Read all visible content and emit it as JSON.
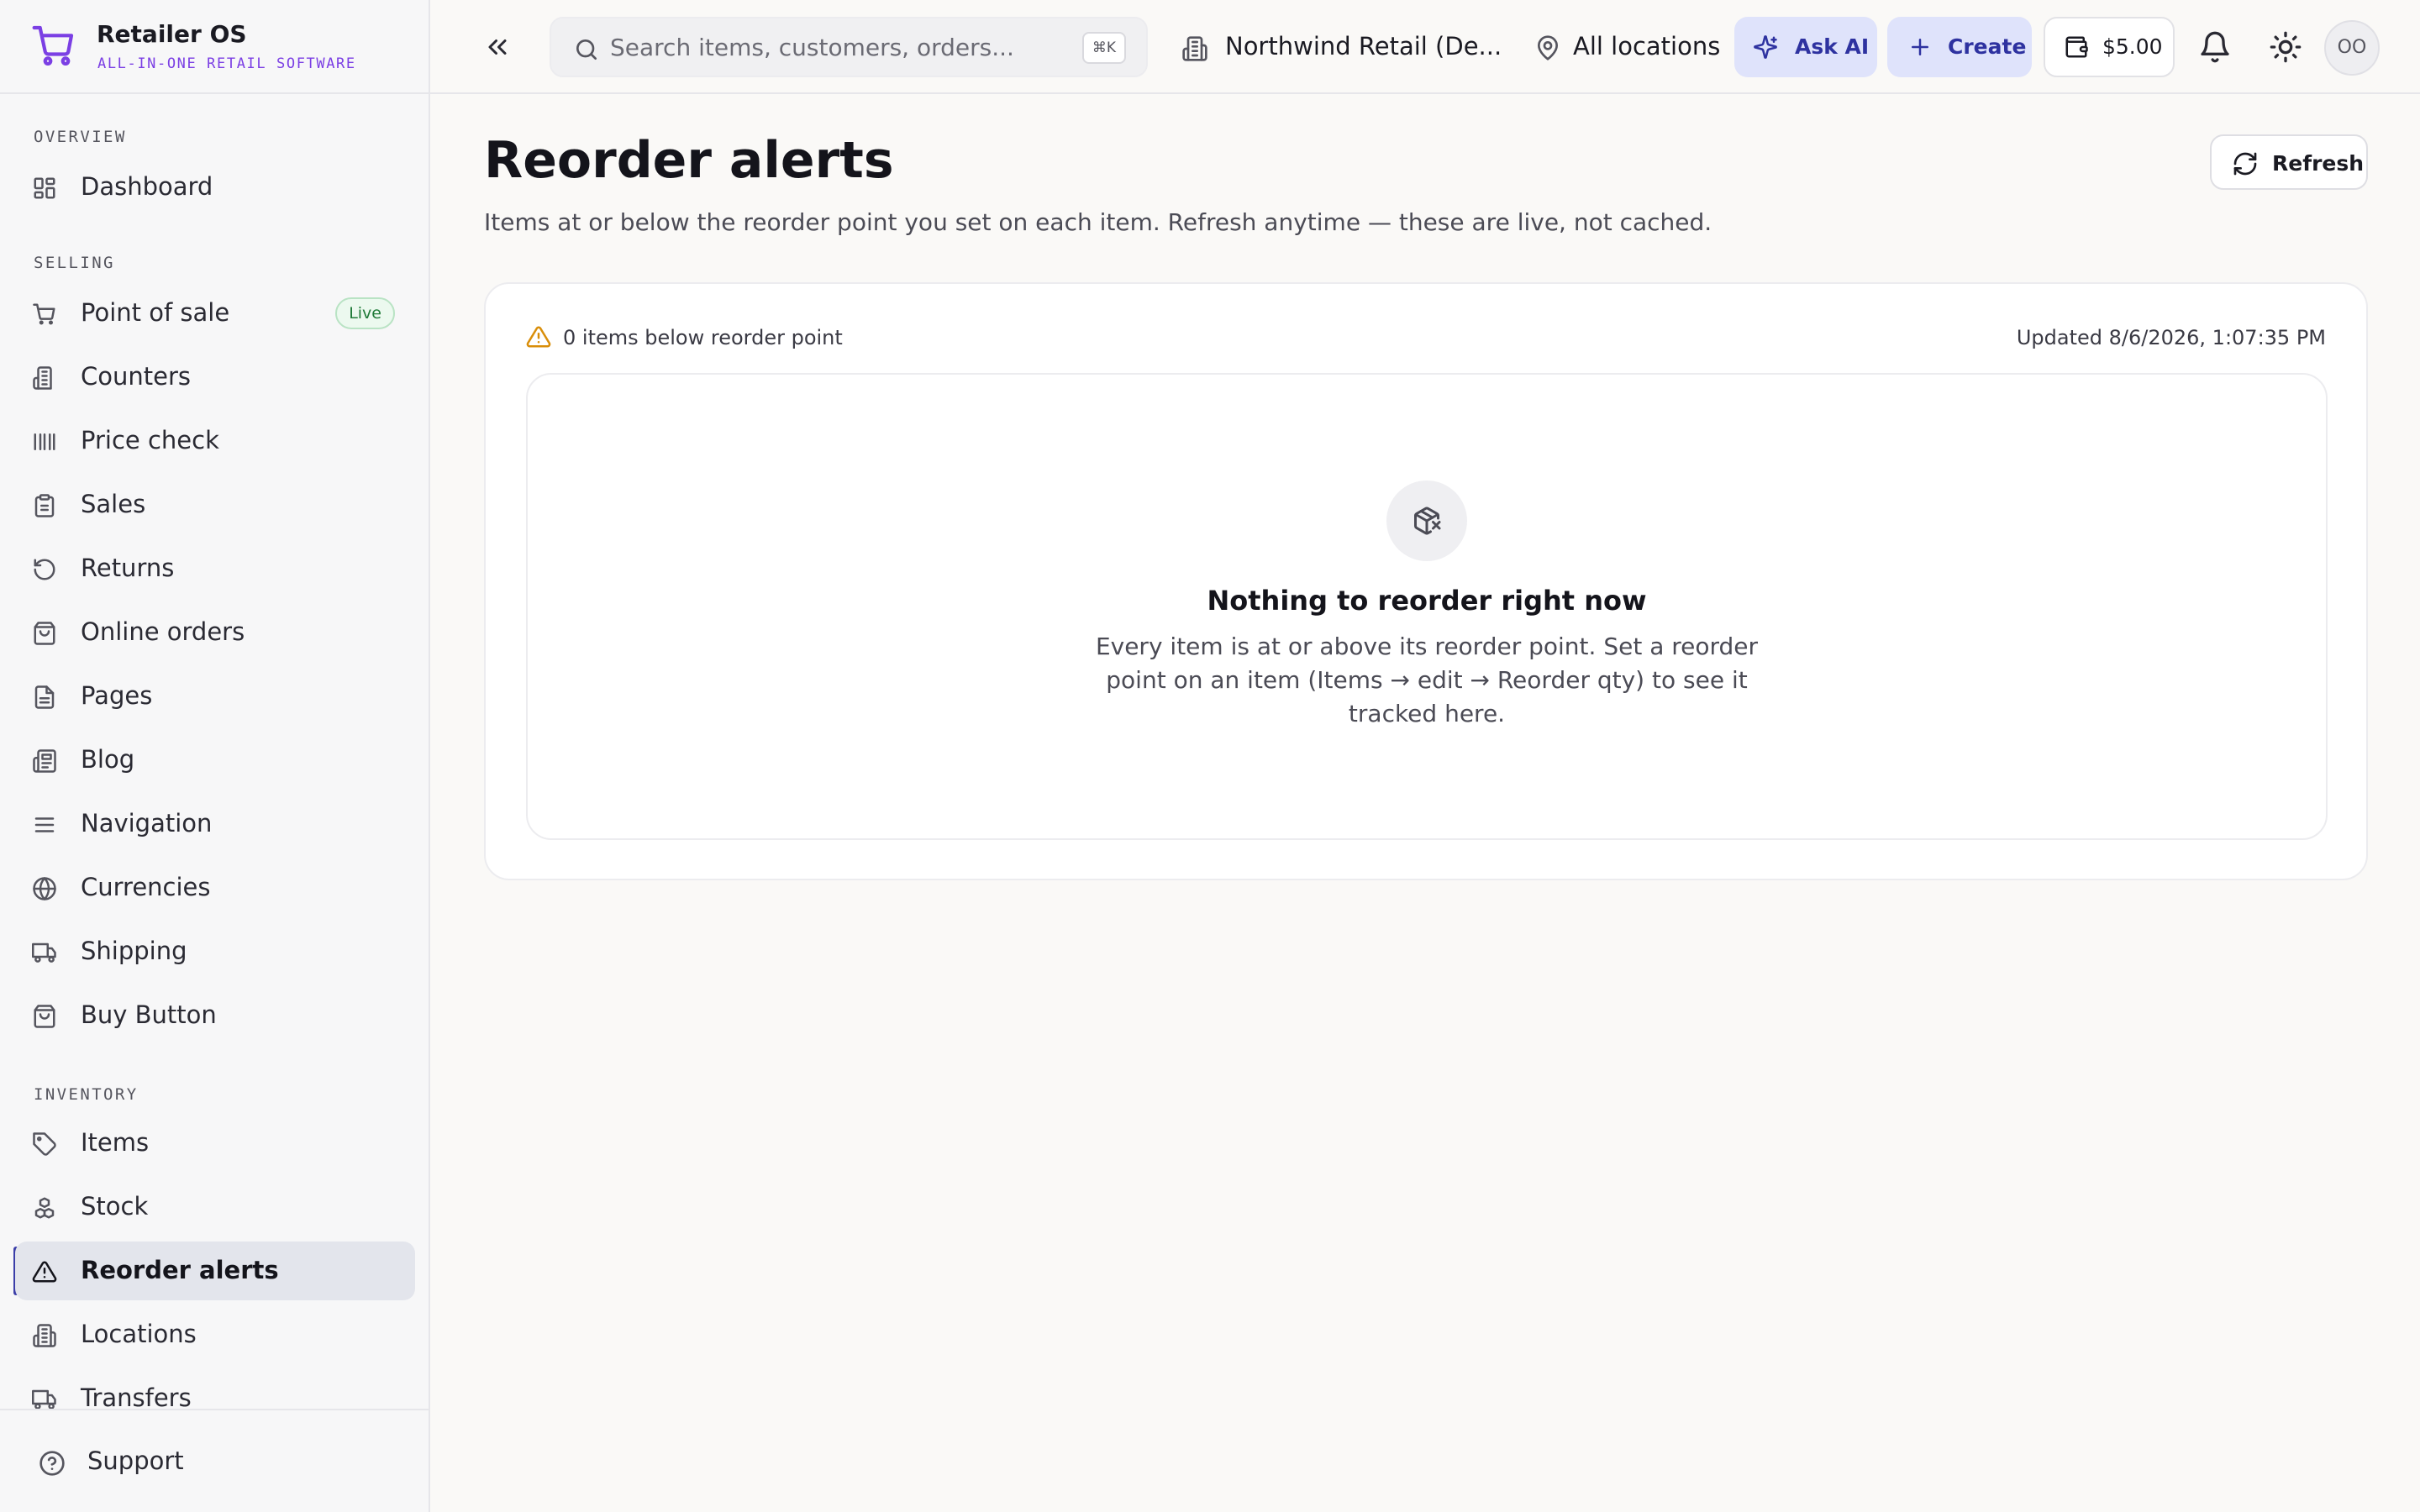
{
  "brand": {
    "name": "Retailer OS",
    "tagline": "ALL-IN-ONE RETAIL SOFTWARE",
    "accent_color": "#7b3fe4"
  },
  "sidebar": {
    "sections": [
      {
        "label": "OVERVIEW"
      },
      {
        "label": "SELLING"
      },
      {
        "label": "INVENTORY"
      }
    ],
    "items": [
      {
        "label": "Dashboard",
        "icon": "grid-icon"
      },
      {
        "label": "Point of sale",
        "icon": "cart-icon",
        "badge": "Live"
      },
      {
        "label": "Counters",
        "icon": "building-icon"
      },
      {
        "label": "Price check",
        "icon": "barcode-icon"
      },
      {
        "label": "Sales",
        "icon": "clipboard-icon"
      },
      {
        "label": "Returns",
        "icon": "rotate-ccw-icon"
      },
      {
        "label": "Online orders",
        "icon": "shopping-bag-icon"
      },
      {
        "label": "Pages",
        "icon": "file-icon"
      },
      {
        "label": "Blog",
        "icon": "newspaper-icon"
      },
      {
        "label": "Navigation",
        "icon": "menu-icon"
      },
      {
        "label": "Currencies",
        "icon": "globe-icon"
      },
      {
        "label": "Shipping",
        "icon": "truck-icon"
      },
      {
        "label": "Buy Button",
        "icon": "shopping-bag-icon"
      },
      {
        "label": "Items",
        "icon": "tag-icon"
      },
      {
        "label": "Stock",
        "icon": "boxes-icon"
      },
      {
        "label": "Reorder alerts",
        "icon": "alert-triangle-icon",
        "active": true
      },
      {
        "label": "Locations",
        "icon": "building-icon"
      },
      {
        "label": "Transfers",
        "icon": "truck-icon"
      }
    ],
    "footer": {
      "support_label": "Support"
    }
  },
  "topbar": {
    "search_placeholder": "Search items, customers, orders...",
    "search_shortcut": "⌘K",
    "tenant": "Northwind Retail (De...",
    "locations": "All locations",
    "ask_ai": "Ask AI",
    "create": "Create",
    "balance": "$5.00",
    "avatar_initials": "OO"
  },
  "page": {
    "title": "Reorder alerts",
    "subtitle": "Items at or below the reorder point you set on each item. Refresh anytime — these are live, not cached.",
    "refresh_label": "Refresh",
    "count_text": "0 items below reorder point",
    "updated_text": "Updated 8/6/2026, 1:07:35 PM",
    "empty_title": "Nothing to reorder right now",
    "empty_desc": "Every item is at or above its reorder point. Set a reorder point on an item (Items → edit → Reorder qty) to see it tracked here."
  },
  "colors": {
    "active_bar": "#3b3ea8",
    "primary_button_bg": "#dfe3fb",
    "primary_button_text": "#2e32a0",
    "warning": "#d98e0a",
    "live_badge": "#1f7a38"
  }
}
